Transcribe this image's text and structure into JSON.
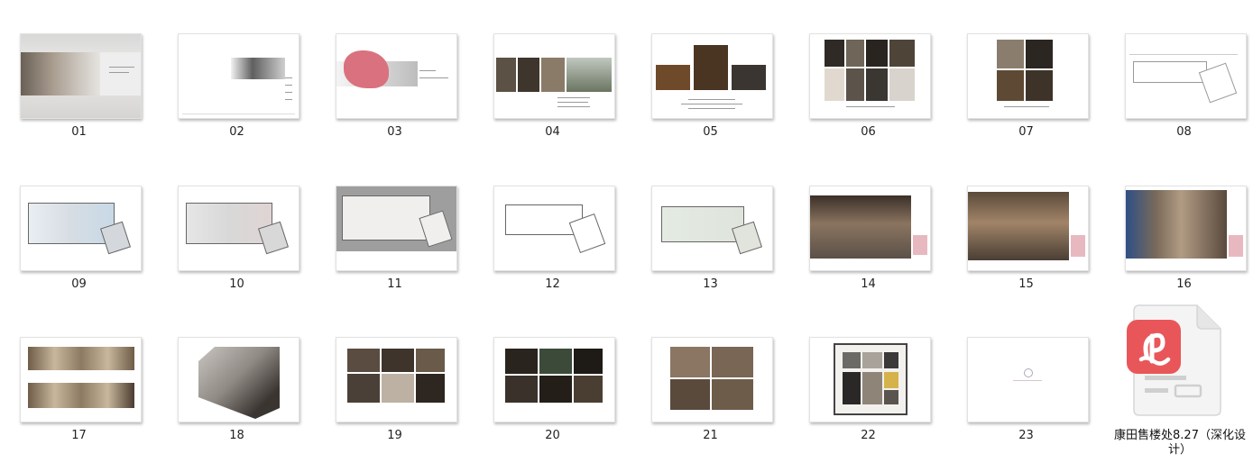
{
  "thumbnails": [
    {
      "label": "01",
      "style": "cover"
    },
    {
      "label": "02",
      "style": "title"
    },
    {
      "label": "03",
      "style": "map"
    },
    {
      "label": "04",
      "style": "photos4"
    },
    {
      "label": "05",
      "style": "photos3"
    },
    {
      "label": "06",
      "style": "collage"
    },
    {
      "label": "07",
      "style": "collage"
    },
    {
      "label": "08",
      "style": "linework"
    },
    {
      "label": "09",
      "style": "plan"
    },
    {
      "label": "10",
      "style": "plan"
    },
    {
      "label": "11",
      "style": "plan-grey"
    },
    {
      "label": "12",
      "style": "linework"
    },
    {
      "label": "13",
      "style": "plan"
    },
    {
      "label": "14",
      "style": "render"
    },
    {
      "label": "15",
      "style": "render"
    },
    {
      "label": "16",
      "style": "render-blue"
    },
    {
      "label": "17",
      "style": "elevation"
    },
    {
      "label": "18",
      "style": "perspective"
    },
    {
      "label": "19",
      "style": "photogrid"
    },
    {
      "label": "20",
      "style": "photogrid-dark"
    },
    {
      "label": "21",
      "style": "photogrid4"
    },
    {
      "label": "22",
      "style": "materials"
    },
    {
      "label": "23",
      "style": "ending"
    }
  ],
  "pdf_file": {
    "name": "康田售楼处8.27（深化设计）",
    "icon": "pdf-file-icon",
    "badge_color": "#e9565a"
  }
}
